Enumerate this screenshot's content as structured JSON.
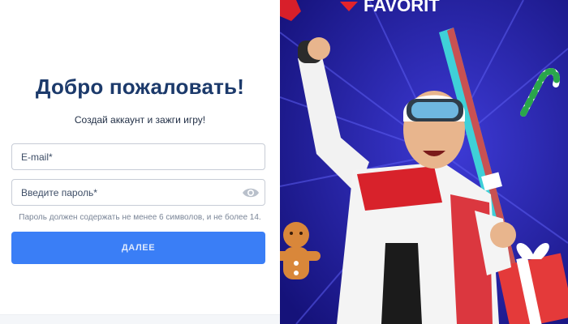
{
  "login": {
    "title": "Добро пожаловать!",
    "subtitle": "Создай аккаунт и зажги игру!",
    "email_placeholder": "E-mail*",
    "password_placeholder": "Введите пароль*",
    "password_hint": "Пароль должен содержать не менее 6 символов, и не более 14.",
    "next_label": "ДАЛЕЕ"
  },
  "banner": {
    "brand": "FAVORIT"
  },
  "colors": {
    "title": "#1c3a6b",
    "button": "#3a7ef6",
    "banner_bg": "#1d1a8a",
    "brand_red": "#e3242b"
  },
  "icons": {
    "password_toggle": "eye-icon"
  }
}
